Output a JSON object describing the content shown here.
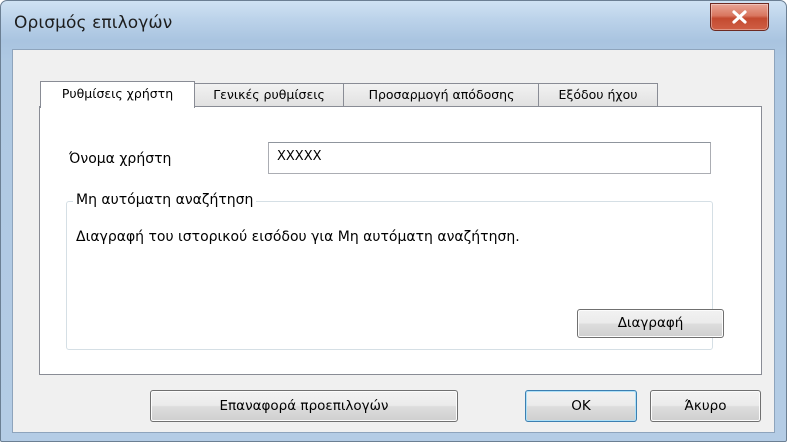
{
  "window": {
    "title": "Ορισμός επιλογών"
  },
  "icons": {
    "close": "close-icon"
  },
  "tabs": [
    {
      "label": "Ρυθμίσεις χρήστη",
      "active": true
    },
    {
      "label": "Γενικές ρυθμίσεις",
      "active": false
    },
    {
      "label": "Προσαρμογή απόδοσης",
      "active": false
    },
    {
      "label": "Εξόδου ήχου",
      "active": false
    }
  ],
  "user_settings": {
    "username_label": "Όνομα χρήστη",
    "username_value": "XXXXX",
    "group_title": "Μη αυτόματη αναζήτηση",
    "group_description": "Διαγραφή του ιστορικού εισόδου για Μη αυτόματη αναζήτηση.",
    "delete_button": "Διαγραφή"
  },
  "footer": {
    "reset_button": "Επαναφορά προεπιλογών",
    "ok_button": "OK",
    "cancel_button": "Άκυρο"
  },
  "colors": {
    "close_button": "#c44a30",
    "title_bar": "#bcd3ea"
  }
}
